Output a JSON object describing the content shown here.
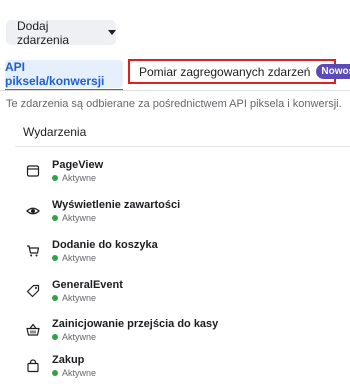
{
  "header": {
    "add_button_label": "Dodaj zdarzenia"
  },
  "tabs": [
    {
      "label": "API piksela/konwersji",
      "active": true
    },
    {
      "label": "Pomiar zagregowanych zdarzeń",
      "badge": "Nowość",
      "active": false
    }
  ],
  "info_text": "Te zdarzenia są odbierane za pośrednictwem API piksela i konwersji.",
  "events_section": {
    "title": "Wydarzenia",
    "items": [
      {
        "name": "PageView",
        "status": "Aktywne",
        "icon": "browser-window-icon"
      },
      {
        "name": "Wyświetlenie zawartości",
        "status": "Aktywne",
        "icon": "eye-icon"
      },
      {
        "name": "Dodanie do koszyka",
        "status": "Aktywne",
        "icon": "cart-icon"
      },
      {
        "name": "GeneralEvent",
        "status": "Aktywne",
        "icon": "tag-icon"
      },
      {
        "name": "Zainicjowanie przejścia do kasy",
        "status": "Aktywne",
        "icon": "basket-icon"
      },
      {
        "name": "Zakup",
        "status": "Aktywne",
        "icon": "shopping-bag-icon"
      }
    ]
  },
  "colors": {
    "active_status": "#31a24c",
    "highlight_border": "#e02020",
    "badge_bg": "#5b4ab7",
    "tab_active_text": "#1f5fd0"
  }
}
